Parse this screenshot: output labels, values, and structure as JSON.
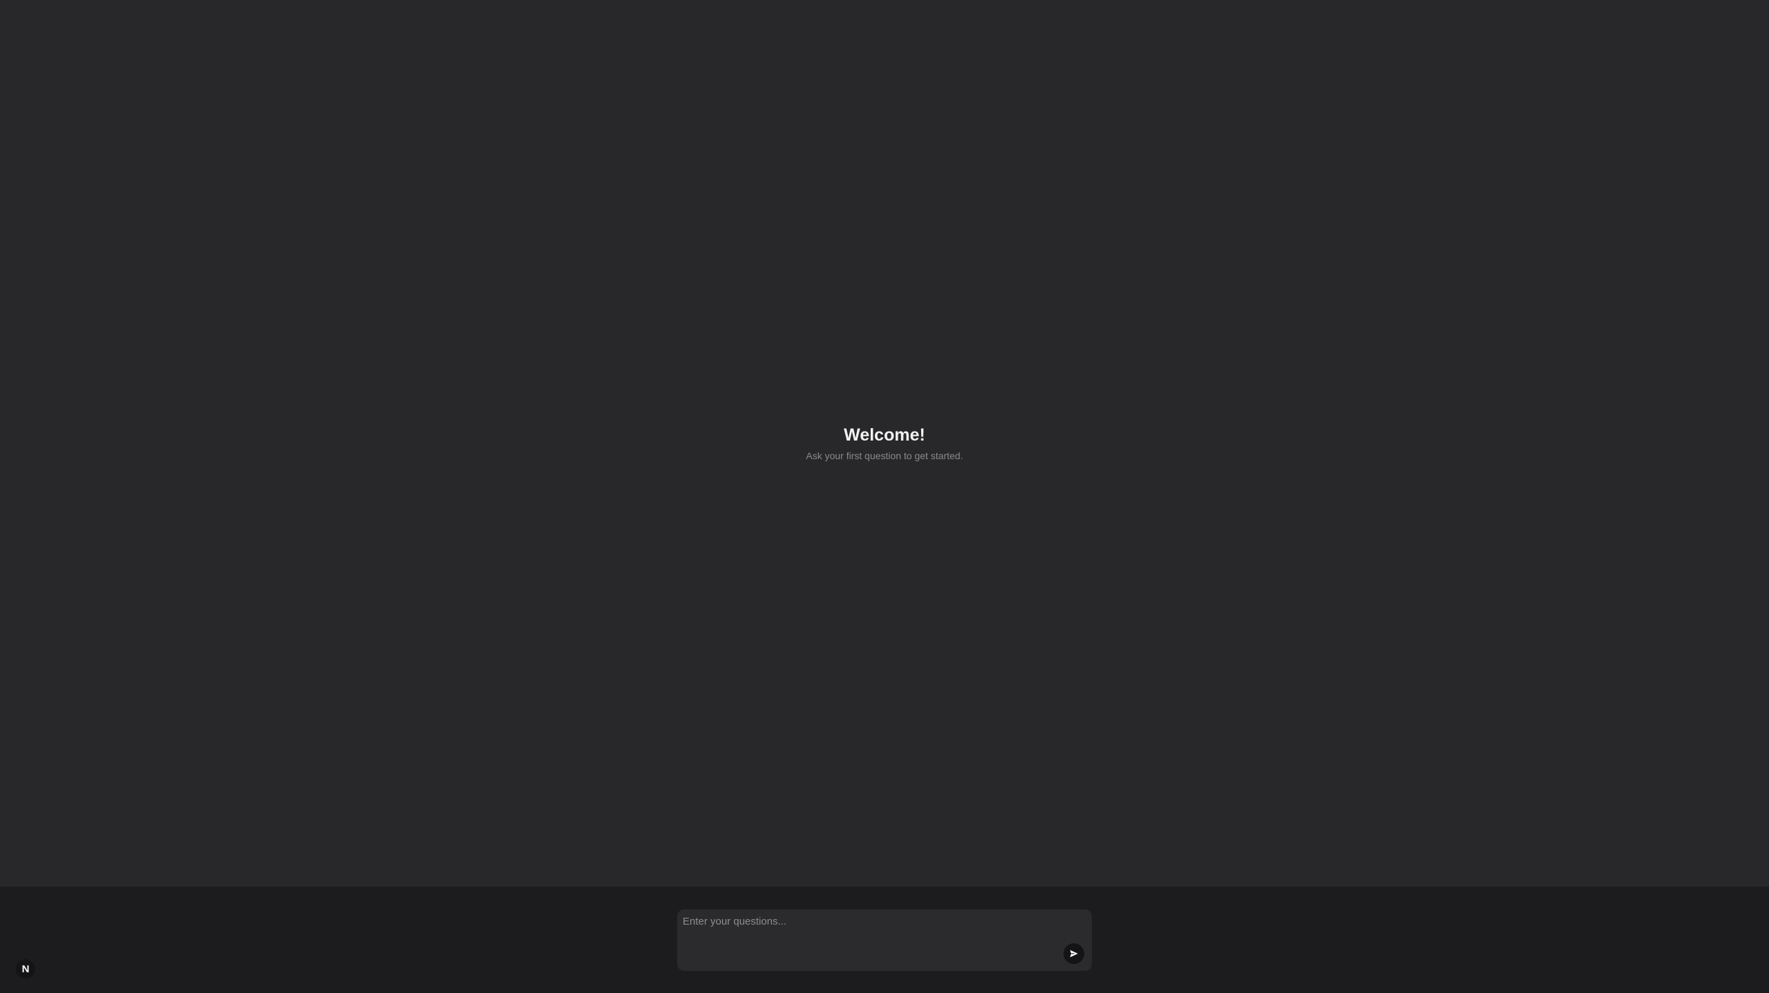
{
  "welcome": {
    "title": "Welcome!",
    "subtitle": "Ask your first question to get started."
  },
  "composer": {
    "placeholder": "Enter your questions...",
    "value": "",
    "send_icon": "send-arrow-icon"
  },
  "badge": {
    "letter": "N",
    "icon": "logo-n-icon"
  },
  "colors": {
    "main_background": "#28282a",
    "footer_background": "#1c1c1e",
    "composer_background": "#2b2b2d",
    "title_text": "#f2f2f2",
    "subtitle_text": "#8a8a8e"
  }
}
